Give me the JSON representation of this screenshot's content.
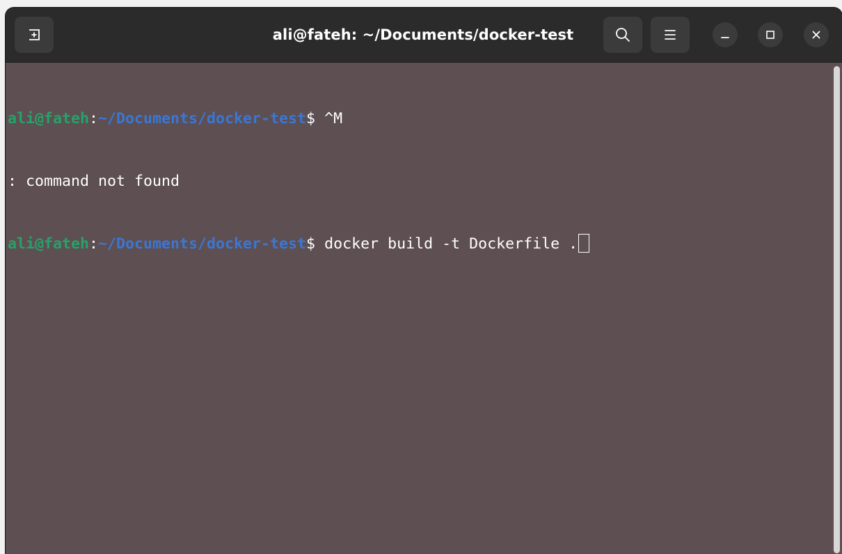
{
  "window": {
    "title": "ali@fateh: ~/Documents/docker-test"
  },
  "header": {
    "new_tab_icon": "new-tab-icon",
    "search_icon": "search-icon",
    "menu_icon": "hamburger-menu-icon",
    "minimize_icon": "minimize-icon",
    "maximize_icon": "maximize-icon",
    "close_icon": "close-icon"
  },
  "terminal": {
    "lines": [
      {
        "user_host": "ali@fateh",
        "colon": ":",
        "path": "~/Documents/docker-test",
        "dollar": "$ ",
        "command": "^M"
      },
      {
        "output": ": command not found"
      },
      {
        "user_host": "ali@fateh",
        "colon": ":",
        "path": "~/Documents/docker-test",
        "dollar": "$ ",
        "command": "docker build -t Dockerfile ."
      }
    ]
  },
  "colors": {
    "background": "#5e4f53",
    "titlebar": "#2b2b2b",
    "user_host": "#26a269",
    "path": "#3b77d3",
    "text": "#ffffff"
  }
}
